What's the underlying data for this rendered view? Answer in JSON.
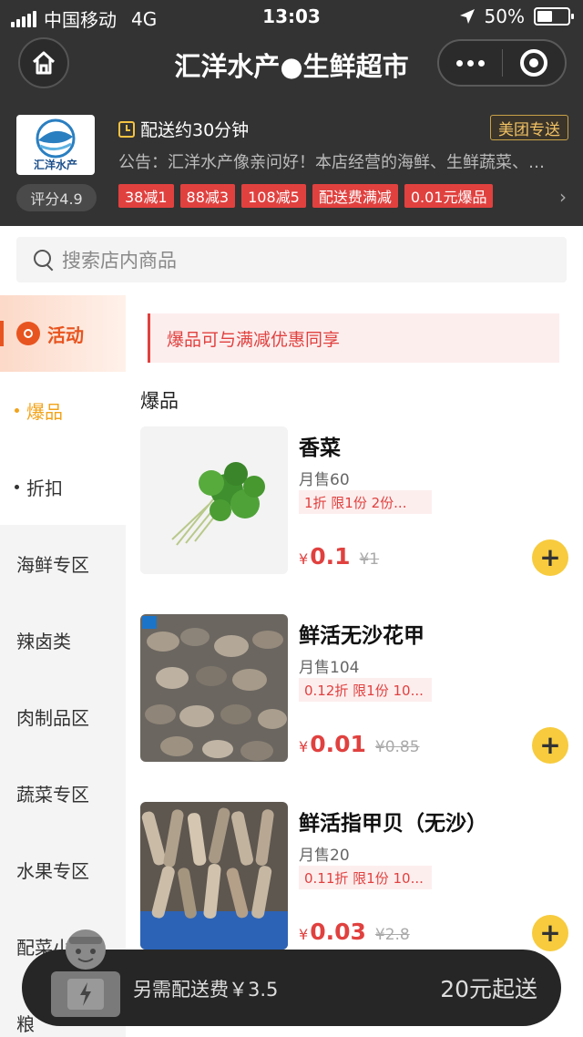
{
  "status_bar": {
    "carrier": "中国移动",
    "network": "4G",
    "time": "13:03",
    "battery": "50%",
    "battery_level": 0.5
  },
  "nav": {
    "title": "汇洋水产●生鲜超市"
  },
  "store": {
    "logo_text": "汇洋水产",
    "rating": "评分4.9",
    "delivery_time": "配送约30分钟",
    "delivery_badge": "美团专送",
    "notice": "公告：汇洋水产像亲问好！本店经营的海鲜、生鲜蔬菜、…",
    "tags": [
      "38减1",
      "88减3",
      "108减5",
      "配送费满减",
      "0.01元爆品"
    ],
    "more_arrow": "›"
  },
  "search": {
    "placeholder": "搜索店内商品"
  },
  "sidebar": {
    "active": "活动",
    "sub_items": [
      "爆品",
      "折扣"
    ],
    "items": [
      "海鲜专区",
      "辣卤类",
      "肉制品区",
      "蔬菜专区",
      "水果专区",
      "配菜小",
      "粮"
    ]
  },
  "main": {
    "banner": "爆品可与满减优惠同享",
    "section_title": "爆品",
    "products": [
      {
        "name": "香菜",
        "sales": "月售60",
        "promo": "1折 限1份 2份...",
        "currency": "¥",
        "price": "0.1",
        "old_price": "¥1"
      },
      {
        "name": "鲜活无沙花甲",
        "sales": "月售104",
        "promo": "0.12折 限1份 10...",
        "currency": "¥",
        "price": "0.01",
        "old_price": "¥0.85"
      },
      {
        "name": "鲜活指甲贝（无沙）",
        "sales": "月售20",
        "promo": "0.11折 限1份 10...",
        "currency": "¥",
        "price": "0.03",
        "old_price": "¥2.8"
      }
    ],
    "add_label": "+"
  },
  "cart": {
    "delivery_fee": "另需配送费￥3.5",
    "min_order": "20元起送"
  },
  "colors": {
    "header_bg": "#333333",
    "accent_red": "#e0413f",
    "accent_orange": "#e8541f",
    "add_yellow": "#f7cb3d"
  }
}
